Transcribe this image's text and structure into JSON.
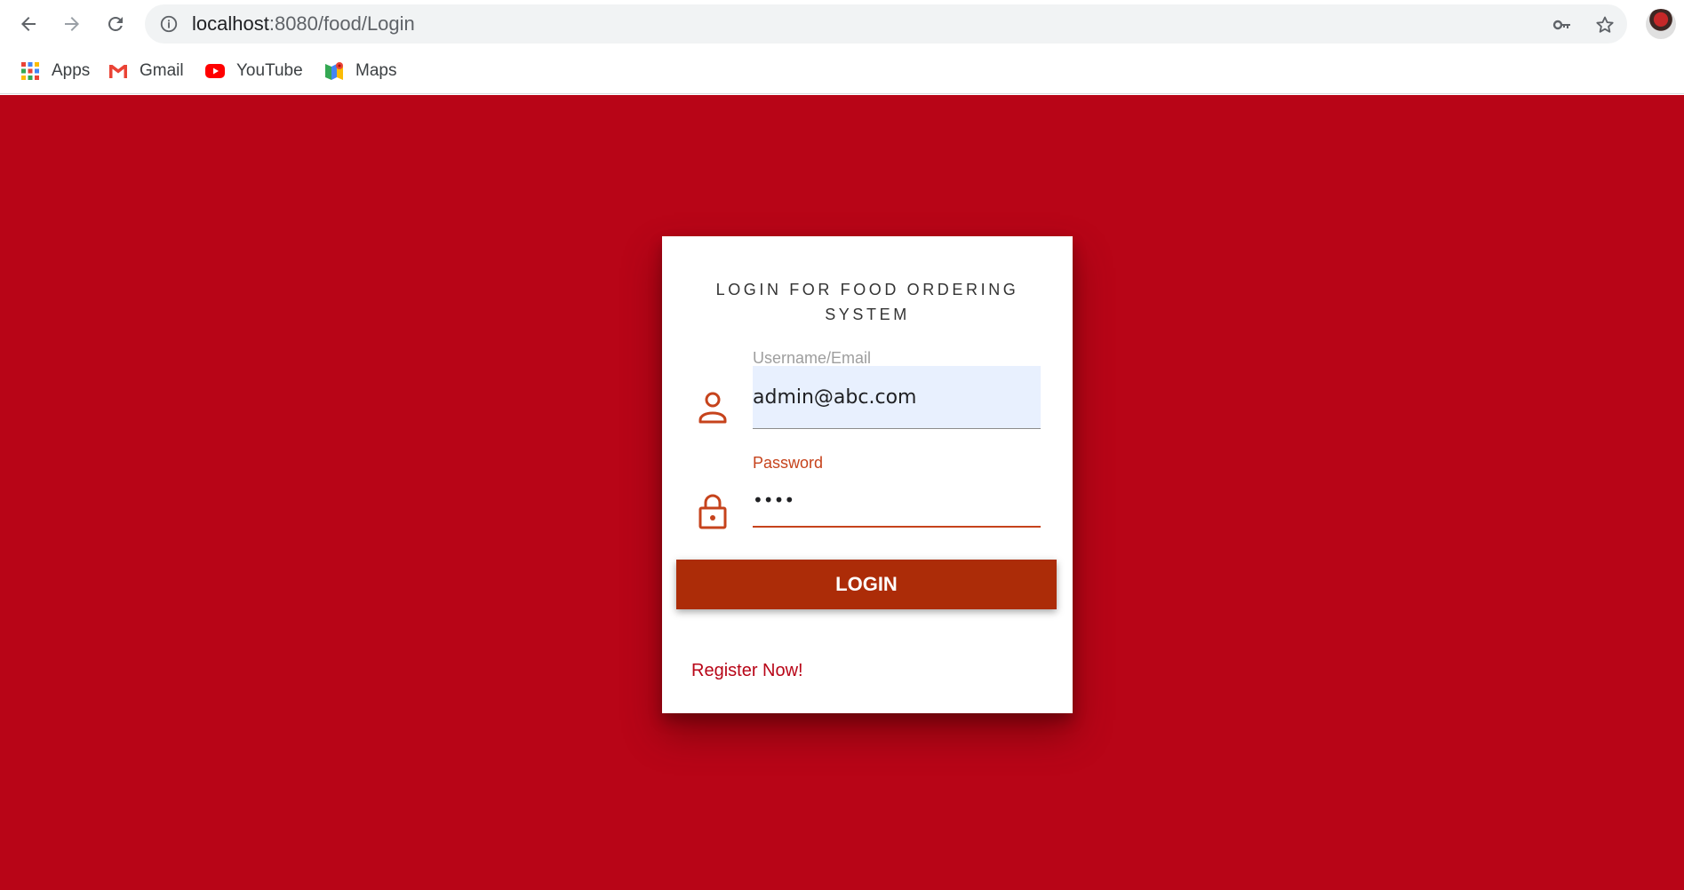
{
  "browser": {
    "url_host": "localhost",
    "url_path": ":8080/food/Login",
    "bookmarks": [
      {
        "label": "Apps",
        "icon": "apps-grid-icon"
      },
      {
        "label": "Gmail",
        "icon": "gmail-icon"
      },
      {
        "label": "YouTube",
        "icon": "youtube-icon"
      },
      {
        "label": "Maps",
        "icon": "maps-icon"
      }
    ]
  },
  "login": {
    "title": "LOGIN FOR FOOD ORDERING SYSTEM",
    "username_label": "Username/Email",
    "username_value": "admin@abc.com",
    "password_label": "Password",
    "password_value": "••••",
    "login_button": "LOGIN",
    "register_link": "Register Now!"
  },
  "colors": {
    "page_background": "#b80517",
    "button": "#ac2c08",
    "accent": "#c6431c"
  }
}
